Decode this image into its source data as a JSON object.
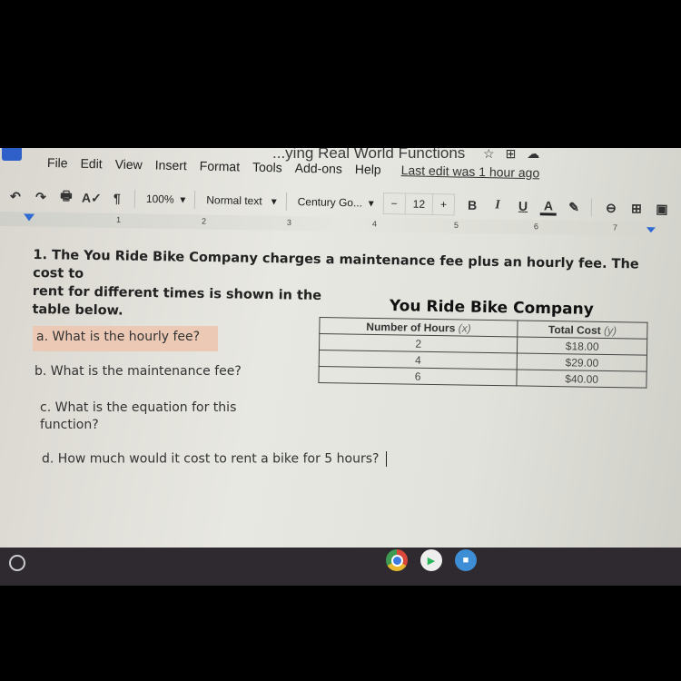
{
  "doc": {
    "title": "...ying Real World Functions",
    "title_icons": [
      "star-icon",
      "move-to-folder-icon",
      "cloud-saved-icon"
    ]
  },
  "menu": {
    "items": [
      "File",
      "Edit",
      "View",
      "Insert",
      "Format",
      "Tools",
      "Add-ons",
      "Help"
    ],
    "last_edit": "Last edit was 1 hour ago"
  },
  "toolbar": {
    "undo": "↶",
    "redo": "↷",
    "print": "🖶",
    "spellcheck": "A✓",
    "paint_format": "¶",
    "zoom": "100%",
    "style": "Normal text",
    "font": "Century Go...",
    "font_size": "12",
    "minus": "−",
    "plus": "+",
    "bold": "B",
    "italic": "I",
    "underline": "U",
    "text_color": "A",
    "highlight": "✎",
    "link": "⊖",
    "comment": "⊞",
    "image": "▣"
  },
  "ruler": {
    "marks": [
      "1",
      "2",
      "3",
      "4",
      "5",
      "6",
      "7"
    ]
  },
  "question": {
    "line1": "1.  The You Ride Bike Company charges a maintenance fee plus an hourly fee.  The cost to",
    "line2": "rent for different times is shown in the",
    "line3": "table below.",
    "a": "a.  What is the hourly fee?",
    "b": "b.  What is the maintenance fee?",
    "c1": "c.  What is the equation for this",
    "c2": "function?",
    "d": "d. How much would it cost to rent a bike for 5 hours?"
  },
  "table": {
    "title": "You Ride Bike Company",
    "headers": [
      {
        "label": "Number of Hours ",
        "var": "(x)"
      },
      {
        "label": "Total Cost ",
        "var": "(y)"
      }
    ],
    "rows": [
      [
        "2",
        "$18.00"
      ],
      [
        "4",
        "$29.00"
      ],
      [
        "6",
        "$40.00"
      ]
    ]
  },
  "shelf": {
    "apps": [
      "Chrome",
      "Play Store",
      "Zoom"
    ]
  },
  "colors": {
    "highlight": "#ecc9b4",
    "docs_blue": "#2f5fc9",
    "shelf": "#2e2a30"
  }
}
